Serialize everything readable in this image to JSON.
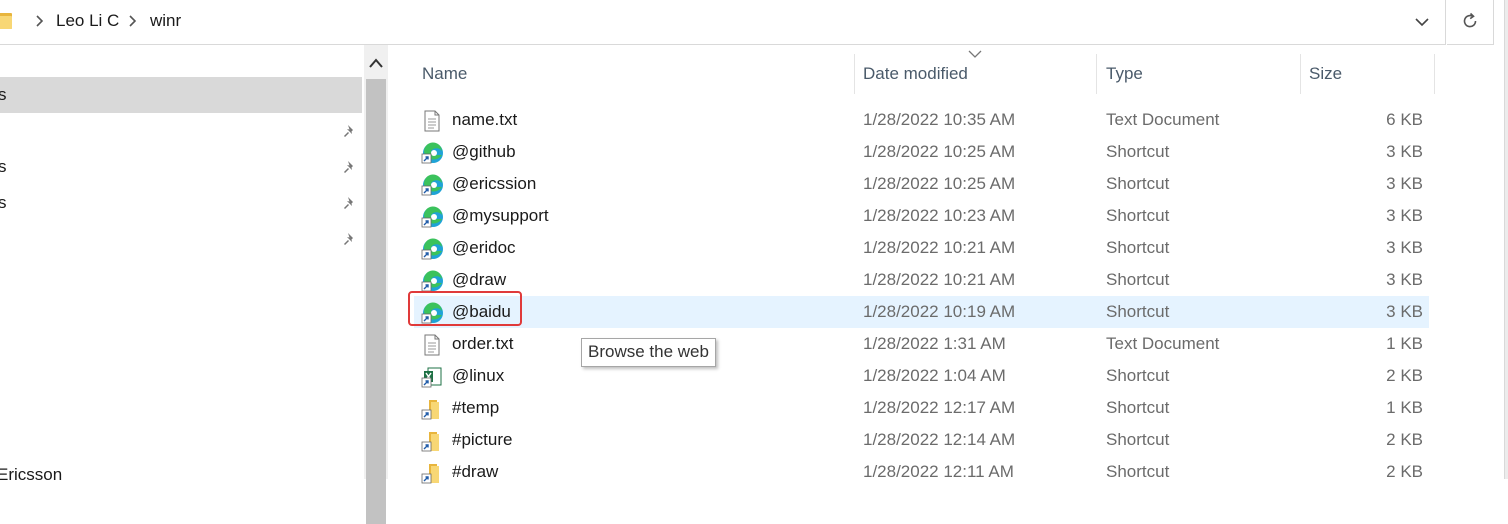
{
  "address_bar": {
    "breadcrumbs": [
      "Leo Li C",
      "winr"
    ],
    "folder_icon": "folder-icon",
    "dropdown_icon": "chevron-down-icon",
    "refresh_icon": "refresh-icon"
  },
  "nav": {
    "items": [
      {
        "label": "s",
        "pinned": false,
        "selected": true
      },
      {
        "label": "",
        "pinned": true
      },
      {
        "label": "s",
        "pinned": true
      },
      {
        "label": "s",
        "pinned": true
      },
      {
        "label": "",
        "pinned": true
      }
    ],
    "bottom_label": "Ericsson"
  },
  "columns": {
    "name": "Name",
    "date": "Date modified",
    "type": "Type",
    "size": "Size"
  },
  "files": [
    {
      "name": "name.txt",
      "date": "1/28/2022 10:35 AM",
      "type": "Text Document",
      "size": "6 KB",
      "icon": "text-file-icon"
    },
    {
      "name": "@github",
      "date": "1/28/2022 10:25 AM",
      "type": "Shortcut",
      "size": "3 KB",
      "icon": "edge-shortcut-icon"
    },
    {
      "name": "@ericssion",
      "date": "1/28/2022 10:25 AM",
      "type": "Shortcut",
      "size": "3 KB",
      "icon": "edge-shortcut-icon"
    },
    {
      "name": "@mysupport",
      "date": "1/28/2022 10:23 AM",
      "type": "Shortcut",
      "size": "3 KB",
      "icon": "edge-shortcut-icon"
    },
    {
      "name": "@eridoc",
      "date": "1/28/2022 10:21 AM",
      "type": "Shortcut",
      "size": "3 KB",
      "icon": "edge-shortcut-icon"
    },
    {
      "name": "@draw",
      "date": "1/28/2022 10:21 AM",
      "type": "Shortcut",
      "size": "3 KB",
      "icon": "edge-shortcut-icon"
    },
    {
      "name": "@baidu",
      "date": "1/28/2022 10:19 AM",
      "type": "Shortcut",
      "size": "3 KB",
      "icon": "edge-shortcut-icon"
    },
    {
      "name": "order.txt",
      "date": "1/28/2022 1:31 AM",
      "type": "Text Document",
      "size": "1 KB",
      "icon": "text-file-icon"
    },
    {
      "name": "@linux",
      "date": "1/28/2022 1:04 AM",
      "type": "Shortcut",
      "size": "2 KB",
      "icon": "excel-shortcut-icon"
    },
    {
      "name": "#temp",
      "date": "1/28/2022 12:17 AM",
      "type": "Shortcut",
      "size": "1 KB",
      "icon": "folder-shortcut-icon"
    },
    {
      "name": "#picture",
      "date": "1/28/2022 12:14 AM",
      "type": "Shortcut",
      "size": "2 KB",
      "icon": "folder-shortcut-icon"
    },
    {
      "name": "#draw",
      "date": "1/28/2022 12:11 AM",
      "type": "Shortcut",
      "size": "2 KB",
      "icon": "folder-shortcut-icon"
    }
  ],
  "tooltip": {
    "text": "Browse the web"
  },
  "highlight_color": "#e5f3ff",
  "annotation_color": "#e03a3a"
}
